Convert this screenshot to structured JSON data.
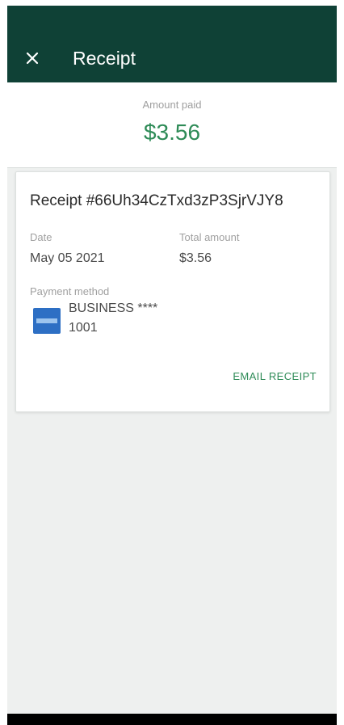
{
  "app_bar": {
    "close_icon": "close-icon",
    "title": "Receipt",
    "background": "#0f4136"
  },
  "summary": {
    "amount_label": "Amount paid",
    "amount_value": "$3.56",
    "accent_color": "#2e8b57"
  },
  "receipt": {
    "id": "Receipt #66Uh34CzTxd3zP3SjrVJY8",
    "date_label": "Date",
    "date_value": "May 05 2021",
    "total_label": "Total amount",
    "total_value": "$3.56",
    "payment_method_label": "Payment method",
    "card_icon": "amex-card-icon",
    "card_name": "BUSINESS ****",
    "card_last4": "1001",
    "email_button": "EMAIL RECEIPT"
  }
}
